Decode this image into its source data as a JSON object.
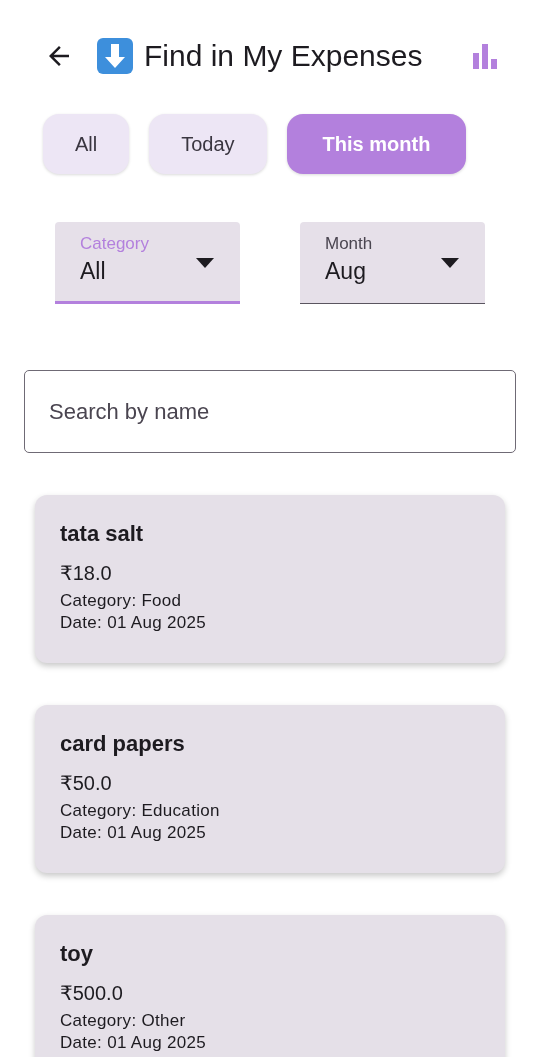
{
  "header": {
    "title": "Find in My Expenses"
  },
  "filters": [
    {
      "label": "All",
      "selected": false
    },
    {
      "label": "Today",
      "selected": false
    },
    {
      "label": "This month",
      "selected": true
    }
  ],
  "dropdowns": [
    {
      "label": "Category",
      "value": "All",
      "focused": true
    },
    {
      "label": "Month",
      "value": "Aug",
      "focused": false
    }
  ],
  "search": {
    "placeholder": "Search by name"
  },
  "expenses": [
    {
      "name": "tata salt",
      "amount": "₹18.0",
      "category": "Category: Food",
      "date": "Date: 01 Aug 2025"
    },
    {
      "name": "card papers",
      "amount": "₹50.0",
      "category": "Category: Education",
      "date": "Date: 01 Aug 2025"
    },
    {
      "name": "toy",
      "amount": "₹500.0",
      "category": "Category: Other",
      "date": "Date: 01 Aug 2025"
    }
  ]
}
